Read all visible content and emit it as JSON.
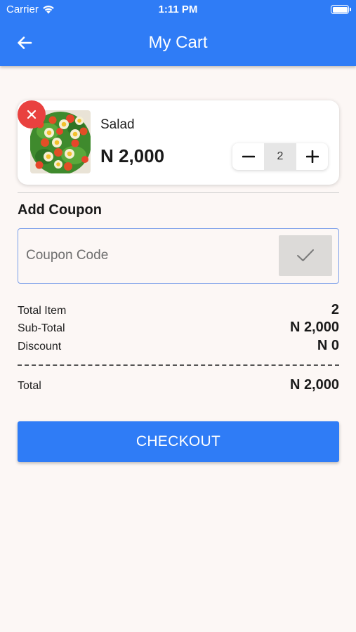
{
  "status_bar": {
    "carrier": "Carrier",
    "time": "1:11 PM"
  },
  "header": {
    "title": "My Cart",
    "back_icon": "arrow-left-icon"
  },
  "cart": {
    "items": [
      {
        "name": "Salad",
        "price": "N 2,000",
        "quantity": "2"
      }
    ]
  },
  "coupon": {
    "heading": "Add Coupon",
    "placeholder": "Coupon Code",
    "value": ""
  },
  "summary": {
    "total_item_label": "Total Item",
    "total_item_value": "2",
    "subtotal_label": "Sub-Total",
    "subtotal_value": "N 2,000",
    "discount_label": "Discount",
    "discount_value": "N 0",
    "total_label": "Total",
    "total_value": "N 2,000"
  },
  "checkout": {
    "label": "CHECKOUT"
  },
  "colors": {
    "primary": "#2f7cf6",
    "remove": "#e9413f",
    "background": "#fcf7f5"
  }
}
